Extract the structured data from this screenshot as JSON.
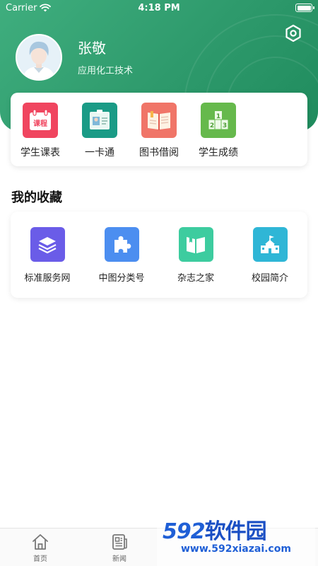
{
  "status_bar": {
    "carrier": "Carrier",
    "time": "4:18 PM"
  },
  "profile": {
    "name": "张敬",
    "major": "应用化工技术"
  },
  "quick_actions": [
    {
      "label": "学生课表",
      "badge": "课程",
      "icon": "calendar-schedule-icon",
      "color": "#f0455f"
    },
    {
      "label": "一卡通",
      "icon": "id-card-icon",
      "color": "#1a9b86"
    },
    {
      "label": "图书借阅",
      "icon": "open-book-icon",
      "color": "#f07568"
    },
    {
      "label": "学生成绩",
      "icon": "podium-ranking-icon",
      "color": "#66b94c",
      "digits": [
        "1",
        "2",
        "3"
      ]
    }
  ],
  "favorites": {
    "title": "我的收藏",
    "items": [
      {
        "label": "标准服务网",
        "icon": "layers-icon",
        "color": "#6a5ce8"
      },
      {
        "label": "中图分类号",
        "icon": "puzzle-icon",
        "color": "#4c8ef0"
      },
      {
        "label": "杂志之家",
        "icon": "magazine-book-icon",
        "color": "#3dcc9f"
      },
      {
        "label": "校园简介",
        "icon": "school-building-icon",
        "color": "#2fb6d6"
      }
    ]
  },
  "tab_bar": {
    "items": [
      {
        "label": "首页",
        "icon": "home-icon"
      },
      {
        "label": "新闻",
        "icon": "news-icon"
      }
    ]
  },
  "watermark": {
    "brand": "592",
    "brand_cn": "软件园",
    "url": "www.592xiazai.com"
  }
}
